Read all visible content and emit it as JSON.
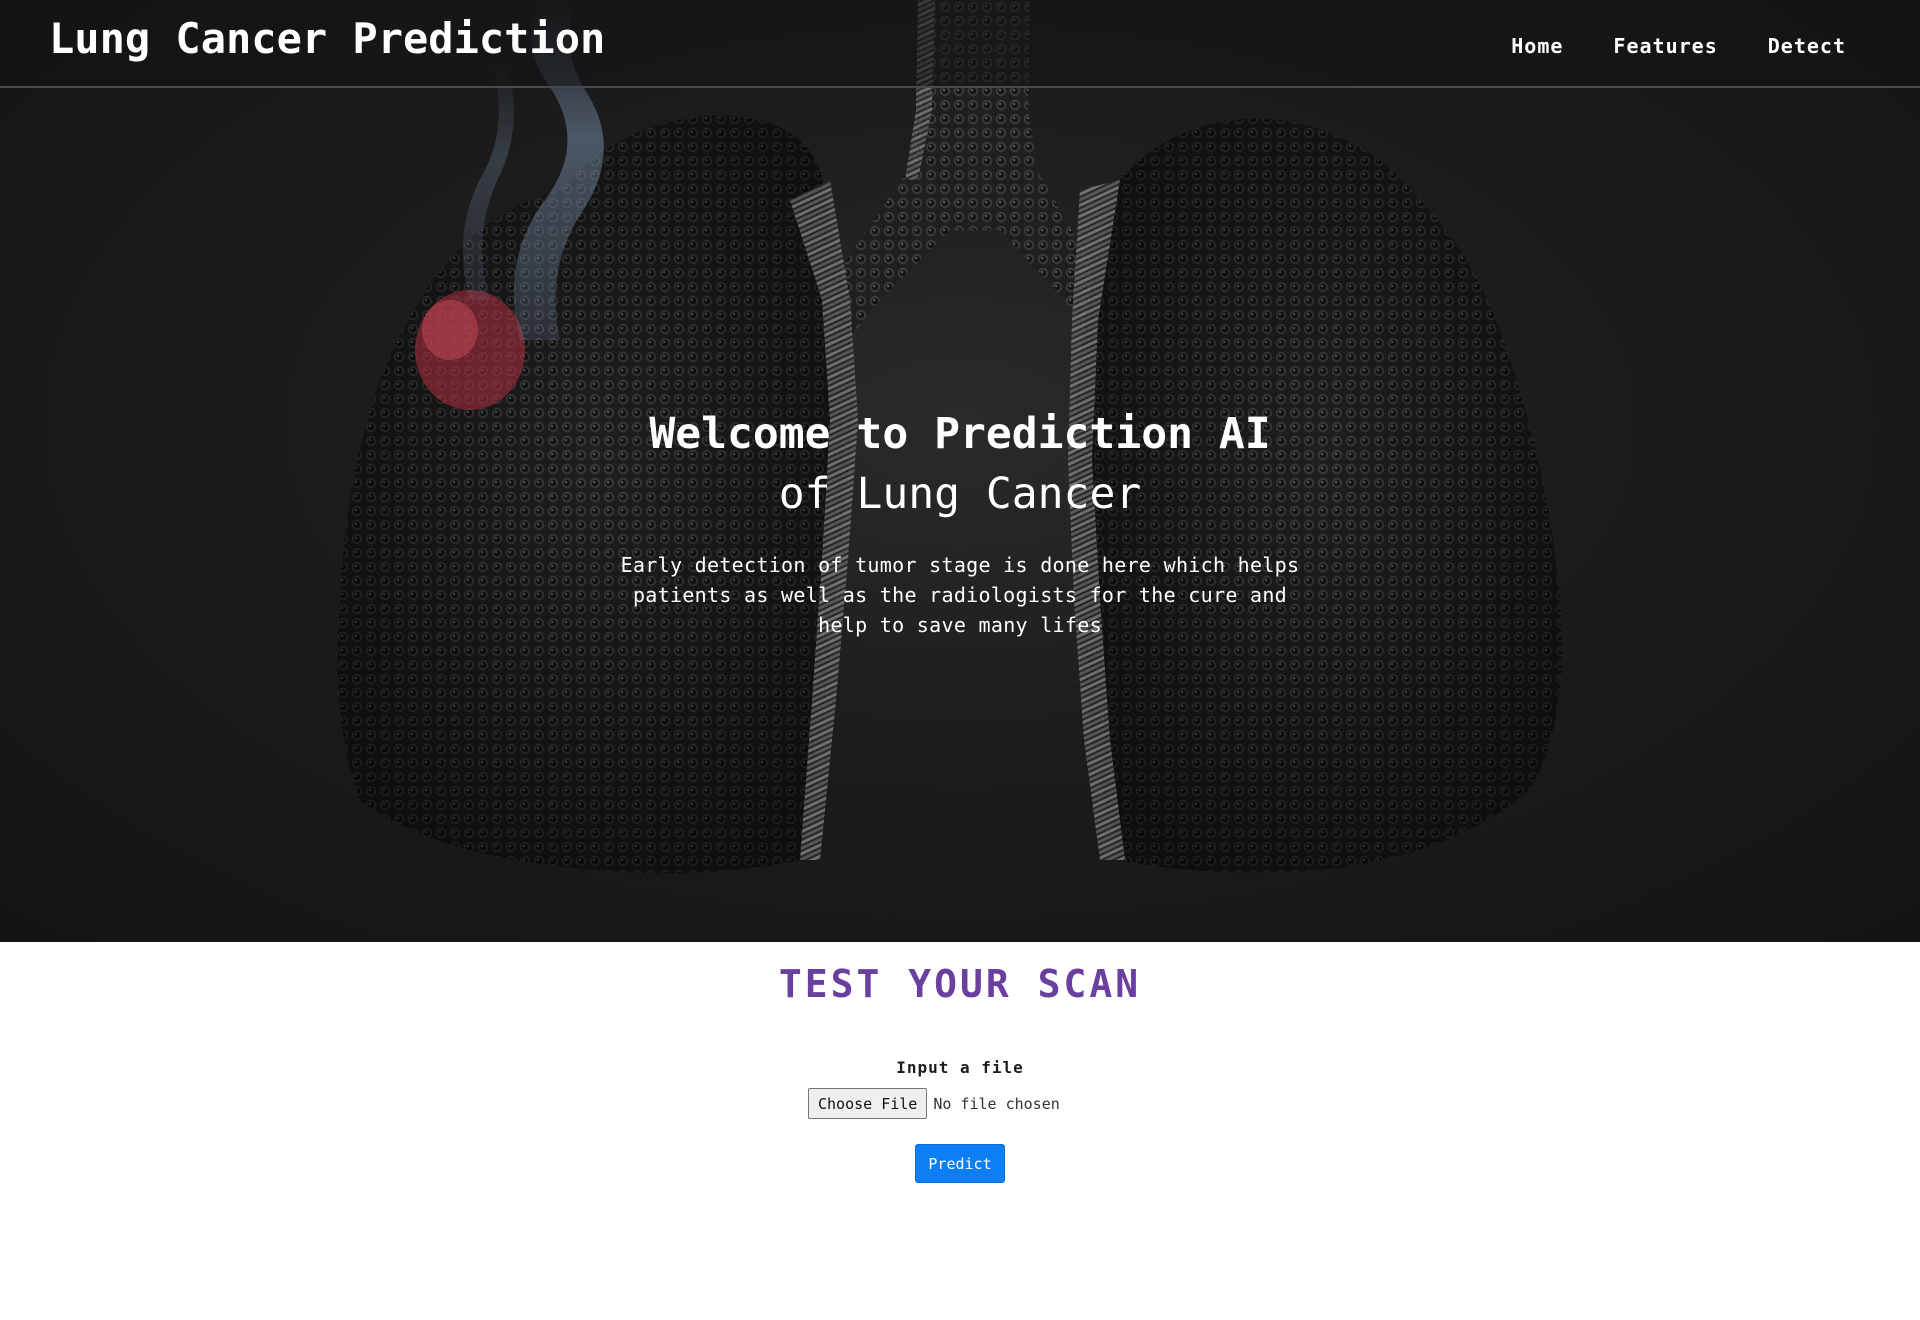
{
  "header": {
    "brand": "Lung Cancer Prediction",
    "nav": [
      {
        "label": "Home"
      },
      {
        "label": "Features"
      },
      {
        "label": "Detect"
      }
    ]
  },
  "hero": {
    "title_line_1": "Welcome to Prediction AI",
    "title_line_2": "of Lung Cancer",
    "description": "Early detection of tumor stage is done here which helps patients as well as the radiologists for the cure and help to save many lifes"
  },
  "test_section": {
    "title": "TEST YOUR SCAN",
    "input_label": "Input a file",
    "file_button_label": "Choose File",
    "file_status": "No file chosen",
    "predict_label": "Predict"
  },
  "colors": {
    "hero_background": "#1c1c1d",
    "section_title": "#6a3fa0",
    "predict_button": "#0d7ff5",
    "tumor_highlight": "#b03040"
  },
  "icons": {
    "hero_image": "lungs-made-of-cigarettes-image"
  }
}
